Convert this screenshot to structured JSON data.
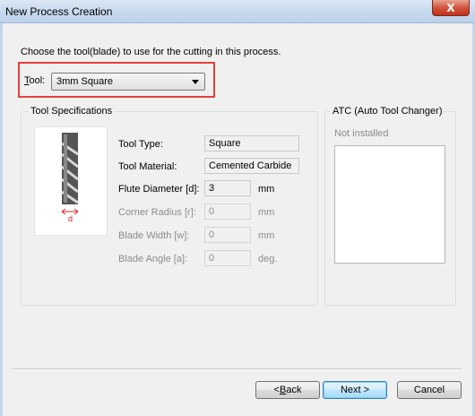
{
  "window": {
    "title": "New Process Creation",
    "close_label": "X"
  },
  "instruction": "Choose the tool(blade) to use for the cutting in this process.",
  "tool": {
    "label_prefix": "T",
    "label_rest": "ool:",
    "selected": "3mm Square"
  },
  "spec": {
    "title": "Tool Specifications",
    "image_label": "d",
    "rows": [
      {
        "label": "Tool Type:",
        "value": "Square",
        "unit": "",
        "enabled": true
      },
      {
        "label": "Tool Material:",
        "value": "Cemented Carbide",
        "unit": "",
        "enabled": true
      },
      {
        "label": "Flute Diameter [d]:",
        "value": "3",
        "unit": "mm",
        "enabled": true
      },
      {
        "label": "Corner Radius [r]:",
        "value": "0",
        "unit": "mm",
        "enabled": false
      },
      {
        "label": "Blade Width [w]:",
        "value": "0",
        "unit": "mm",
        "enabled": false
      },
      {
        "label": "Blade Angle [a]:",
        "value": "0",
        "unit": "deg.",
        "enabled": false
      }
    ]
  },
  "atc": {
    "title": "ATC (Auto Tool Changer)",
    "status": "Not installed"
  },
  "buttons": {
    "back": {
      "pre": "< ",
      "key": "B",
      "post": "ack"
    },
    "next": "Next >",
    "cancel": "Cancel"
  },
  "colors": {
    "highlight": "#e8403a",
    "close": "#c1301b"
  }
}
